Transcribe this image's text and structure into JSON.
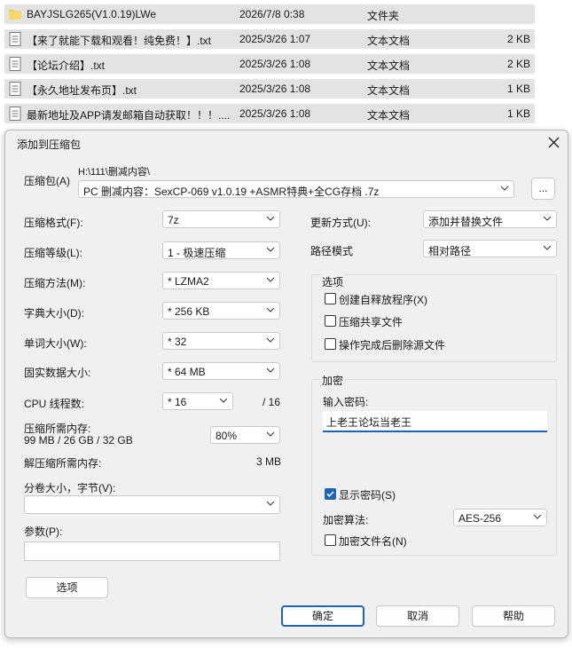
{
  "files": [
    {
      "name": "BAYJSLG265(V1.0.19)LWe",
      "date": "2026/7/8 0:38",
      "type": "文件夹",
      "size": "",
      "icon": "folder-icon"
    },
    {
      "name": "【来了就能下载和观看！纯免费！】.txt",
      "date": "2025/3/26 1:07",
      "type": "文本文档",
      "size": "2 KB",
      "icon": "text-file-icon"
    },
    {
      "name": "【论坛介绍】.txt",
      "date": "2025/3/26 1:08",
      "type": "文本文档",
      "size": "2 KB",
      "icon": "text-file-icon"
    },
    {
      "name": "【永久地址发布页】.txt",
      "date": "2025/3/26 1:08",
      "type": "文本文档",
      "size": "1 KB",
      "icon": "text-file-icon"
    },
    {
      "name": "最新地址及APP请发邮箱自动获取！！！....",
      "date": "2025/3/26 1:08",
      "type": "文本文档",
      "size": "1 KB",
      "icon": "text-file-icon"
    }
  ],
  "dialog": {
    "title": "添加到压缩包",
    "archive_label": "压缩包(A)",
    "archive_path": "H:\\111\\删减内容\\",
    "archive_name": "PC 删减内容：SexCP-069 v1.0.19 +ASMR特典+全CG存档 .7z",
    "browse_label": "...",
    "left": [
      {
        "label": "压缩格式(F):",
        "value": "7z"
      },
      {
        "label": "压缩等级(L):",
        "value": "1 - 极速压缩"
      },
      {
        "label": "压缩方法(M):",
        "value": "* LZMA2"
      },
      {
        "label": "字典大小(D):",
        "value": "* 256 KB"
      },
      {
        "label": "单词大小(W):",
        "value": "* 32"
      },
      {
        "label": "固实数据大小:",
        "value": "* 64 MB"
      }
    ],
    "cpu_label": "CPU 线程数:",
    "cpu_value": "* 16",
    "cpu_total": "/ 16",
    "mem_label": "压缩所需内存:",
    "mem_detail": "99 MB / 26 GB / 32 GB",
    "mem_percent": "80%",
    "decomp_label": "解压缩所需内存:",
    "decomp_value": "3 MB",
    "split_label": "分卷大小，字节(V):",
    "split_value": "",
    "params_label": "参数(P):",
    "params_value": "",
    "options_button": "选项",
    "update_label": "更新方式(U):",
    "update_value": "添加并替换文件",
    "pathmode_label": "路径模式",
    "pathmode_value": "相对路径",
    "opts_group_title": "选项",
    "opts": [
      {
        "label": "创建自释放程序(X)",
        "checked": false
      },
      {
        "label": "压缩共享文件",
        "checked": false
      },
      {
        "label": "操作完成后删除源文件",
        "checked": false
      }
    ],
    "enc_group_title": "加密",
    "pwd_label": "输入密码:",
    "pwd_value": "上老王论坛当老王",
    "show_pwd_label": "显示密码(S)",
    "show_pwd_checked": true,
    "enc_method_label": "加密算法:",
    "enc_method_value": "AES-256",
    "enc_names_label": "加密文件名(N)",
    "enc_names_checked": false,
    "ok_label": "确定",
    "cancel_label": "取消",
    "help_label": "帮助"
  },
  "colors": {
    "accent": "#1f63b4",
    "list_bg": "#e3e3e3",
    "dialog_bg": "#f0f0f0"
  }
}
